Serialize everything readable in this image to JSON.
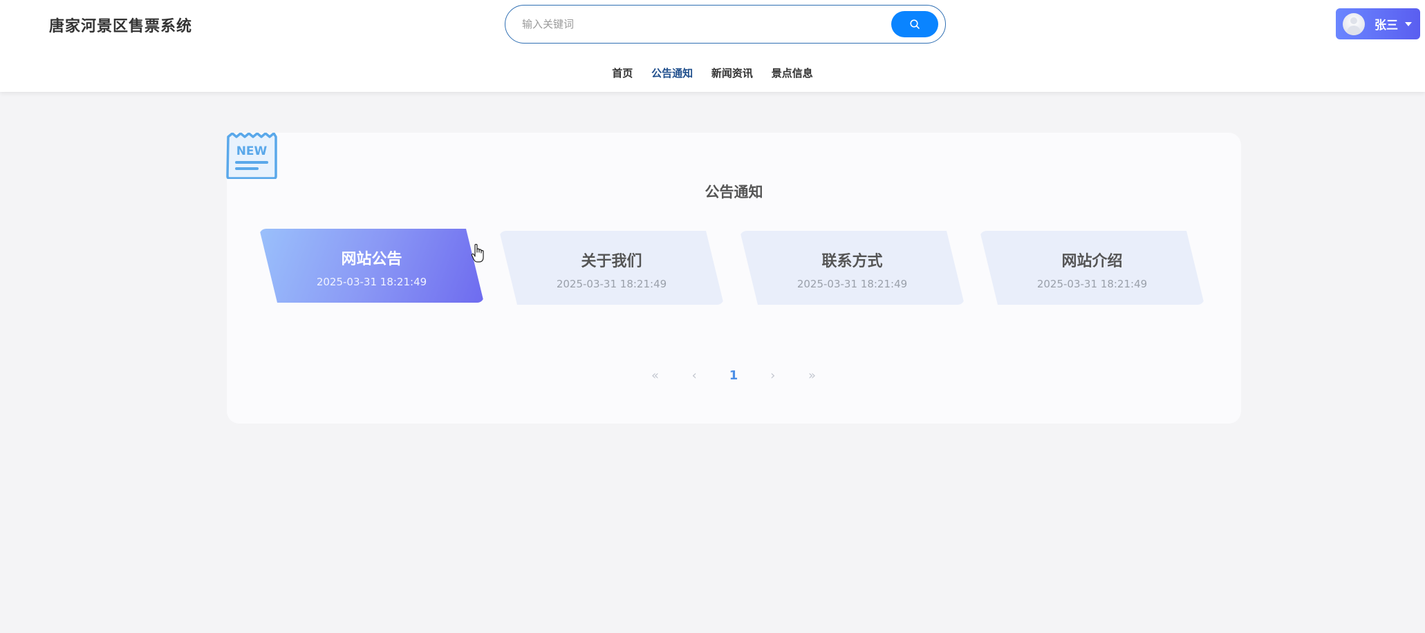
{
  "header": {
    "site_title": "唐家河景区售票系统",
    "search": {
      "placeholder": "输入关键词",
      "value": "",
      "button_icon": "search-icon"
    },
    "user": {
      "name": "张三",
      "avatar_icon": "avatar-icon",
      "dropdown_icon": "caret-down-icon"
    }
  },
  "nav": {
    "items": [
      {
        "label": "首页",
        "active": false
      },
      {
        "label": "公告通知",
        "active": true
      },
      {
        "label": "新闻资讯",
        "active": false
      },
      {
        "label": "景点信息",
        "active": false
      }
    ]
  },
  "main": {
    "badge_text": "NEW",
    "title": "公告通知",
    "cards": [
      {
        "title": "网站公告",
        "date": "2025-03-31 18:21:49",
        "active": true
      },
      {
        "title": "关于我们",
        "date": "2025-03-31 18:21:49",
        "active": false
      },
      {
        "title": "联系方式",
        "date": "2025-03-31 18:21:49",
        "active": false
      },
      {
        "title": "网站介绍",
        "date": "2025-03-31 18:21:49",
        "active": false
      }
    ],
    "pagination": {
      "first": "«",
      "prev": "‹",
      "current": "1",
      "next": "›",
      "last": "»"
    }
  },
  "colors": {
    "accent": "#0a84ff",
    "nav_active": "#1f4e8c",
    "user_button": "#5a5ef0",
    "badge": "#5aa8ea"
  }
}
